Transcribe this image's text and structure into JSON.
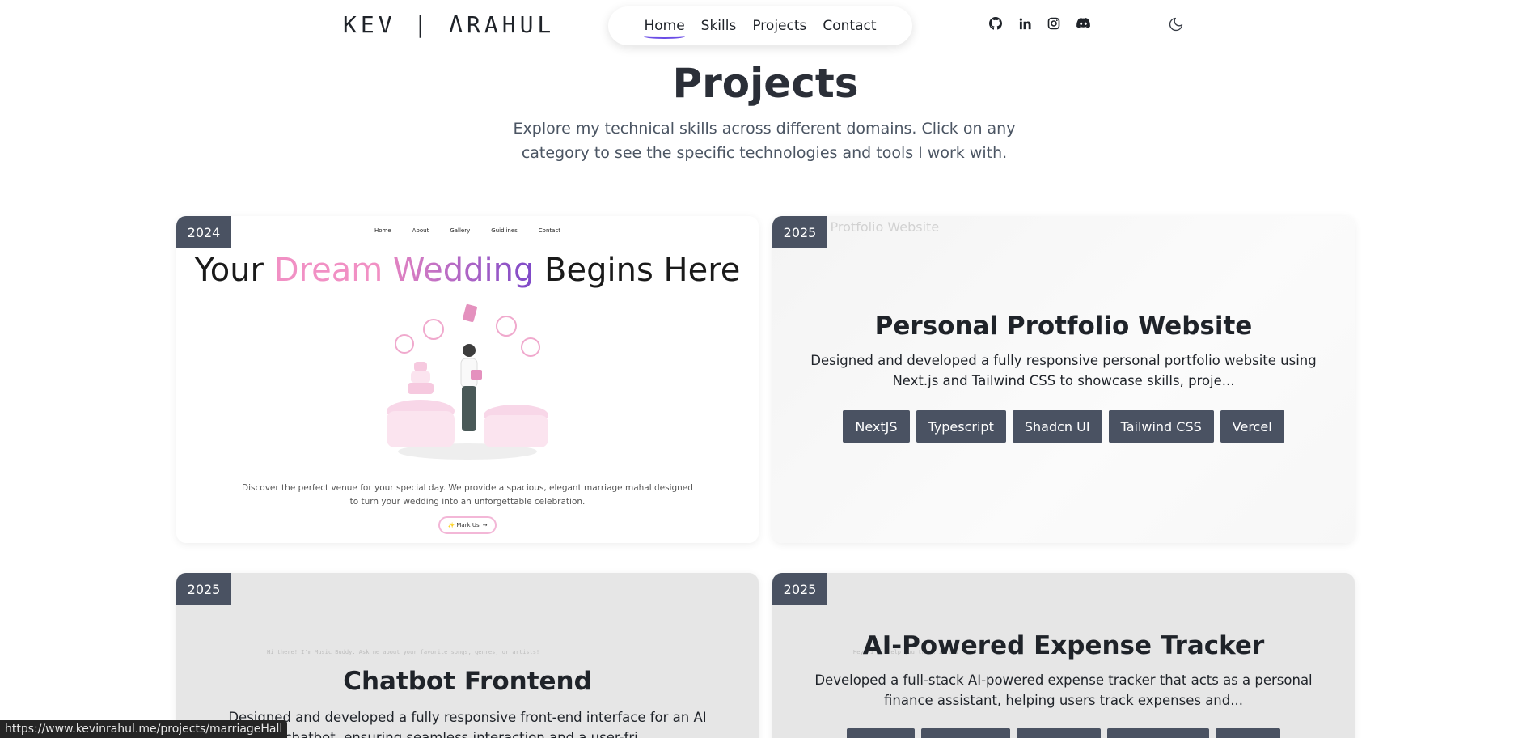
{
  "header": {
    "logo": "KEV | ΛRAHUL",
    "nav": [
      {
        "label": "Home",
        "active": true
      },
      {
        "label": "Skills",
        "active": false
      },
      {
        "label": "Projects",
        "active": false
      },
      {
        "label": "Contact",
        "active": false
      }
    ],
    "socials": [
      "github-icon",
      "linkedin-icon",
      "instagram-icon",
      "discord-icon"
    ],
    "theme_toggle_icon": "moon-icon"
  },
  "hero": {
    "title": "Projects",
    "subtitle": "Explore my technical skills across different domains. Click on any category to see the specific technologies and tools I work with."
  },
  "projects": [
    {
      "year": "2024",
      "preview": {
        "nav": [
          "Home",
          "About",
          "Gallery",
          "Guidlines",
          "Contact"
        ],
        "title_a": "Your ",
        "title_b": "Dream ",
        "title_c": "Wedding",
        "title_d": " Begins Here",
        "description": "Discover the perfect venue for your special day. We provide a spacious, elegant marriage mahal designed to turn your wedding into an unforgettable celebration.",
        "button": "✨ Mark Us"
      }
    },
    {
      "year": "2025",
      "ghost_text": "l Protfolio Website",
      "title": "Personal Protfolio Website",
      "description": "Designed and developed a fully responsive personal portfolio website using Next.js and Tailwind CSS to showcase skills, proje...",
      "tags": [
        "NextJS",
        "Typescript",
        "Shadcn UI",
        "Tailwind CSS",
        "Vercel"
      ]
    },
    {
      "year": "2025",
      "ghost_text": "Hi there! I'm Music Buddy. Ask me about your favorite songs, genres, or artists!",
      "title": "Chatbot Frontend",
      "description": "Designed and developed a fully responsive front-end interface for an AI chatbot, ensuring seamless interaction and a user-fri..."
    },
    {
      "year": "2025",
      "ghost_text": "Hey! I'll help you track it all",
      "title": "AI-Powered Expense Tracker",
      "description": "Developed a full-stack AI-powered expense tracker that acts as a personal finance assistant, helping users track expenses and..."
    }
  ],
  "status_bar": {
    "url": "https://www.kevinrahul.me/projects/marriageHall"
  },
  "colors": {
    "tag_bg": "#4a5262",
    "nav_underline": "#6b4de6",
    "pink": "#f190c4"
  }
}
